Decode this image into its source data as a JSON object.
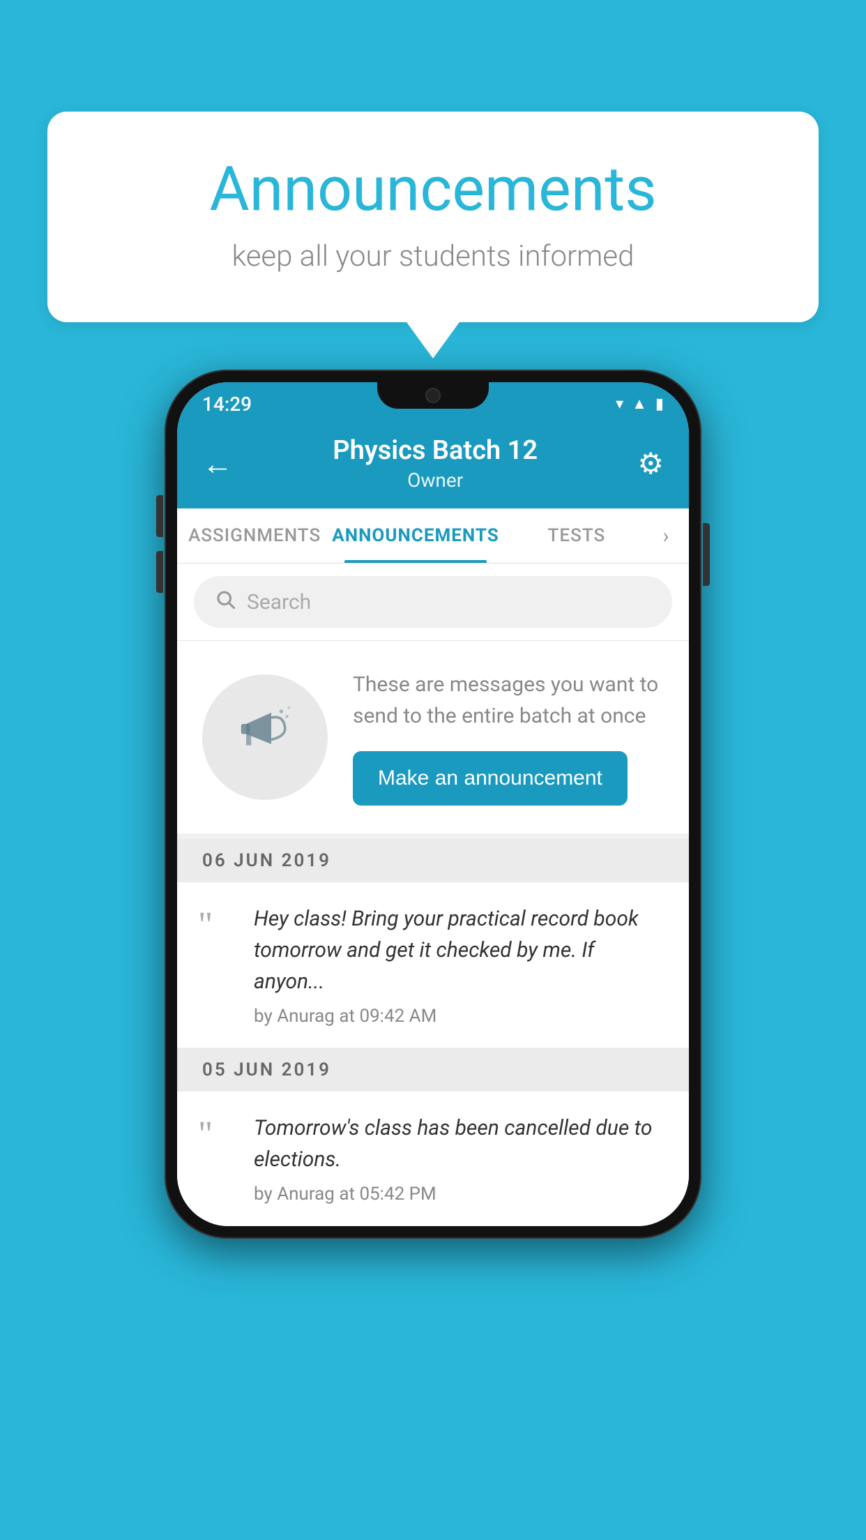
{
  "background_color": "#29b6d8",
  "speech_bubble": {
    "title": "Announcements",
    "subtitle": "keep all your students informed"
  },
  "phone": {
    "status_bar": {
      "time": "14:29",
      "icons": [
        "wifi",
        "signal",
        "battery"
      ]
    },
    "header": {
      "back_label": "←",
      "title": "Physics Batch 12",
      "subtitle": "Owner",
      "gear_label": "⚙"
    },
    "tabs": [
      {
        "label": "ASSIGNMENTS",
        "active": false
      },
      {
        "label": "ANNOUNCEMENTS",
        "active": true
      },
      {
        "label": "TESTS",
        "active": false
      }
    ],
    "search": {
      "placeholder": "Search"
    },
    "promo": {
      "text": "These are messages you want to send to the entire batch at once",
      "button_label": "Make an announcement"
    },
    "announcements": [
      {
        "date_header": "06  JUN  2019",
        "text": "Hey class! Bring your practical record book tomorrow and get it checked by me. If anyon...",
        "meta": "by Anurag at 09:42 AM"
      },
      {
        "date_header": "05  JUN  2019",
        "text": "Tomorrow's class has been cancelled due to elections.",
        "meta": "by Anurag at 05:42 PM"
      }
    ]
  }
}
